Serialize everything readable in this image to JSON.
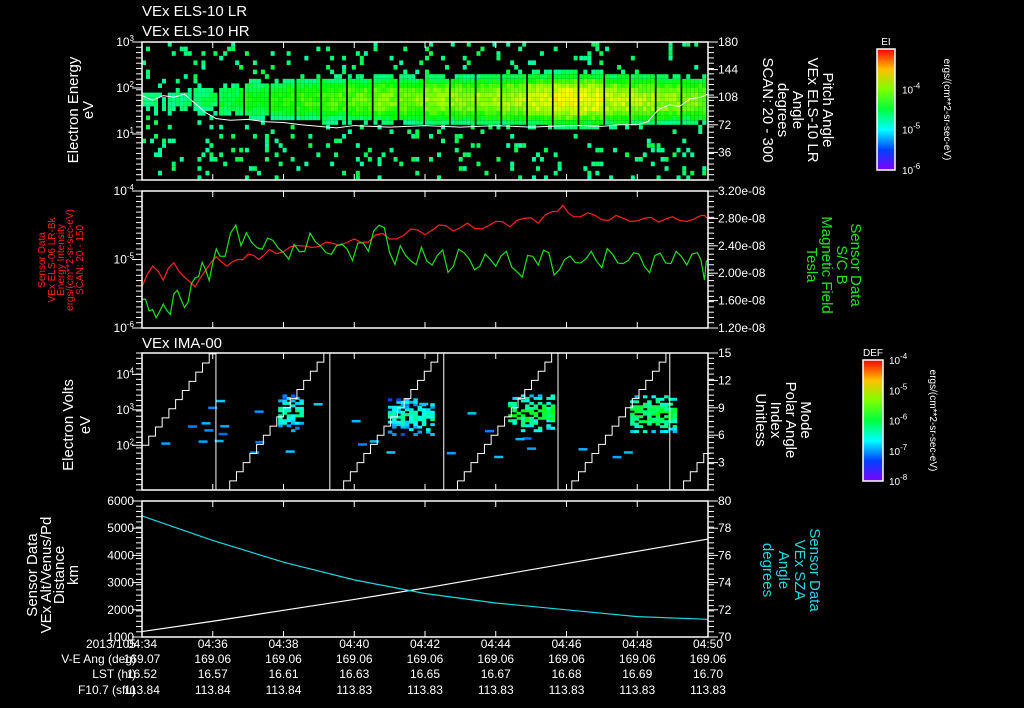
{
  "titles": {
    "p1_line1": "VEx ELS-10 LR",
    "p1_line2": "VEx ELS-10 HR",
    "p3": "VEx IMA-00"
  },
  "colors": {
    "background": "#000000",
    "axes": "#ffffff",
    "red_series": "#ff2020",
    "green_series": "#20e020",
    "cyan_series": "#20d8e0",
    "white_series": "#ffffff"
  },
  "chart_data": [
    {
      "id": "els_spectrogram",
      "type": "heatmap",
      "ylabel": [
        "Electron Energy",
        "eV"
      ],
      "yticks": [
        "10^1",
        "10^2",
        "10^3"
      ],
      "ylim": [
        1,
        1000
      ],
      "yscale": "log",
      "y2label": [
        "Pitch Angle",
        "VEx ELS-10 LR",
        "Angle",
        "degrees",
        "SCAN: 20 - 300"
      ],
      "y2ticks": [
        "36",
        "72",
        "108",
        "144",
        "180"
      ],
      "y2lim": [
        0,
        180
      ],
      "colorbar": {
        "label": "EI",
        "ticks": [
          "10^-4",
          "10^-5",
          "10^-6"
        ],
        "units": "ergs/(cm**2-sr-sec-eV)"
      },
      "band_center_eV": 50,
      "band_peak_level": [
        0.48,
        0.5,
        0.52,
        0.56,
        0.6,
        0.62,
        0.64,
        0.66,
        0.68,
        0.7,
        0.7,
        0.72,
        0.72,
        0.73,
        0.74,
        0.78,
        0.82,
        0.8,
        0.76,
        0.74,
        0.72,
        0.7
      ],
      "pitch_angle_line": {
        "t_min": [
          0,
          0.3,
          0.6,
          0.9,
          1.2,
          1.5,
          1.8,
          2.1,
          2.5,
          3,
          3.5,
          4,
          4.5,
          5,
          5.5,
          6,
          6.5,
          7,
          7.5,
          8,
          8.5,
          9,
          9.5,
          10,
          10.5,
          11,
          11.5,
          12,
          12.5,
          13,
          13.5,
          14,
          14.3,
          14.6,
          14.9,
          15.2,
          15.5,
          15.8,
          16
        ],
        "deg": [
          110,
          104,
          110,
          108,
          112,
          100,
          88,
          80,
          78,
          79,
          76,
          75,
          72,
          70,
          68,
          71,
          70,
          69,
          70,
          71,
          70,
          69,
          70,
          71,
          70,
          69,
          70,
          71,
          71,
          70,
          72,
          72,
          76,
          92,
          98,
          96,
          106,
          108,
          112
        ]
      }
    },
    {
      "id": "energy_intensity_and_bfield",
      "type": "line",
      "ylabel": [
        "Sensor Data",
        "VEx ELS-06 LR-Bk",
        "Energy Intensity",
        "ergs/(cm**2-sr-sec-eV)",
        "SCAN: 20 - 150"
      ],
      "yticks": [
        "10^-6",
        "10^-5",
        "10^-4"
      ],
      "ylim": [
        1e-06,
        0.0001
      ],
      "yscale": "log",
      "y2label": [
        "Sensor Data",
        "S/C B",
        "Magnetic Field",
        "Tesla"
      ],
      "y2ticks": [
        "1.20e-08",
        "1.60e-08",
        "2.00e-08",
        "2.40e-08",
        "2.80e-08",
        "3.20e-08"
      ],
      "y2lim": [
        1.2e-08,
        3.2e-08
      ],
      "series": [
        {
          "name": "Energy Intensity",
          "axis": "left",
          "color": "#ff2020",
          "t_min": [
            0,
            0.3,
            0.6,
            0.9,
            1.2,
            1.5,
            1.8,
            2.1,
            2.4,
            2.7,
            3.0,
            3.3,
            3.6,
            4.0,
            4.4,
            4.8,
            5.2,
            5.6,
            6.0,
            6.4,
            6.8,
            7.2,
            7.6,
            8.0,
            8.4,
            8.8,
            9.2,
            9.6,
            10.0,
            10.4,
            10.8,
            11.2,
            11.6,
            11.9,
            12.2,
            12.6,
            13.0,
            13.4,
            13.8,
            14.2,
            14.6,
            15.0,
            15.4,
            15.8,
            16.0
          ],
          "values": [
            4e-06,
            8e-06,
            5e-06,
            9e-06,
            5.5e-06,
            4e-06,
            7e-06,
            1.1e-05,
            8e-06,
            1e-05,
            1.2e-05,
            1e-05,
            1.4e-05,
            1.3e-05,
            1.6e-05,
            1.5e-05,
            1.8e-05,
            1.6e-05,
            2e-05,
            1.8e-05,
            2.4e-05,
            2e-05,
            2.8e-05,
            2.3e-05,
            3.2e-05,
            2.6e-05,
            3.4e-05,
            2.8e-05,
            3.6e-05,
            3e-05,
            4e-05,
            3.4e-05,
            5e-05,
            6.2e-05,
            4.2e-05,
            4.8e-05,
            3.8e-05,
            4.4e-05,
            3.6e-05,
            4e-05,
            3.5e-05,
            4.2e-05,
            3.6e-05,
            4.4e-05,
            3.9e-05
          ]
        },
        {
          "name": "S/C B Magnetic Field",
          "axis": "right",
          "color": "#20e020",
          "t_min": [
            0,
            0.2,
            0.4,
            0.6,
            0.8,
            1.0,
            1.2,
            1.4,
            1.6,
            1.8,
            2.0,
            2.2,
            2.5,
            2.8,
            3.1,
            3.4,
            3.7,
            4.0,
            4.3,
            4.6,
            4.9,
            5.2,
            5.5,
            5.8,
            6.1,
            6.4,
            6.7,
            7.0,
            7.3,
            7.6,
            7.9,
            8.2,
            8.5,
            8.8,
            9.1,
            9.4,
            9.7,
            10.0,
            10.3,
            10.6,
            10.9,
            11.2,
            11.5,
            11.8,
            12.1,
            12.4,
            12.7,
            13.0,
            13.3,
            13.6,
            13.9,
            14.2,
            14.5,
            14.8,
            15.1,
            15.4,
            15.7,
            15.9,
            16.0
          ],
          "values": [
            1.62e-08,
            1.45e-08,
            1.35e-08,
            1.55e-08,
            1.4e-08,
            1.75e-08,
            1.5e-08,
            1.85e-08,
            1.95e-08,
            2.05e-08,
            2.15e-08,
            2.25e-08,
            2.58e-08,
            2.4e-08,
            2.45e-08,
            2.35e-08,
            2.48e-08,
            2.3e-08,
            2.42e-08,
            2.32e-08,
            2.46e-08,
            2.3e-08,
            2.4e-08,
            2.35e-08,
            2.44e-08,
            2.32e-08,
            2.7e-08,
            2.3e-08,
            2.4e-08,
            2.18e-08,
            2.38e-08,
            2.12e-08,
            2.34e-08,
            2.1e-08,
            2.3e-08,
            2.05e-08,
            2.28e-08,
            2.1e-08,
            2.32e-08,
            2.02e-08,
            2.26e-08,
            2.12e-08,
            2.3e-08,
            2.05e-08,
            2.25e-08,
            2.15e-08,
            2.32e-08,
            2.08e-08,
            2.28e-08,
            2.14e-08,
            2.3e-08,
            2.1e-08,
            2.26e-08,
            2.15e-08,
            2.32e-08,
            2.12e-08,
            2.3e-08,
            1.9e-08,
            2.2e-08
          ]
        }
      ]
    },
    {
      "id": "ima_spectrogram",
      "type": "heatmap",
      "ylabel": [
        "Electron Volts",
        "eV"
      ],
      "yticks": [
        "10^2",
        "10^3",
        "10^4"
      ],
      "ylim": [
        5.5,
        40000
      ],
      "yscale": "log",
      "y2label": [
        "Mode",
        "Polar Angle",
        "Index",
        "Unitless"
      ],
      "y2ticks": [
        "3",
        "6",
        "9",
        "12",
        "15"
      ],
      "y2lim": [
        0,
        15
      ],
      "colorbar": {
        "label": "DEF",
        "ticks": [
          "10^-4",
          "10^-5",
          "10^-6",
          "10^-7",
          "10^-8"
        ],
        "units": "ergs/(cm**2-sr-sec-eV)"
      },
      "blobs": [
        {
          "t_min": 4.2,
          "eV": 900,
          "width_min": 0.7,
          "level": 0.5
        },
        {
          "t_min": 7.6,
          "eV": 700,
          "width_min": 1.3,
          "level": 0.5
        },
        {
          "t_min": 11.0,
          "eV": 900,
          "width_min": 1.3,
          "level": 0.6
        },
        {
          "t_min": 14.4,
          "eV": 850,
          "width_min": 1.2,
          "level": 0.6
        }
      ],
      "scan_reset_t_min": [
        2.09,
        5.31,
        8.53,
        11.76,
        14.92
      ],
      "polar_index_start": 4.9
    },
    {
      "id": "altitude_sza",
      "type": "line",
      "ylabel": [
        "Sensor Data",
        "VEx Alt/Venus/Pd",
        "Distance",
        "km"
      ],
      "yticks": [
        "1000",
        "2000",
        "3000",
        "4000",
        "5000",
        "6000"
      ],
      "ylim": [
        1000,
        6000
      ],
      "y2label": [
        "Sensor Data",
        "VEx SZA",
        "Angle",
        "degrees"
      ],
      "y2ticks": [
        "70",
        "72",
        "74",
        "76",
        "78",
        "80"
      ],
      "y2lim": [
        70,
        80
      ],
      "series": [
        {
          "name": "Altitude",
          "axis": "left",
          "color": "#ffffff",
          "t_min": [
            0,
            2,
            4,
            6,
            8,
            10,
            12,
            14,
            16
          ],
          "values": [
            1200,
            1580,
            1980,
            2380,
            2800,
            3250,
            3700,
            4150,
            4600
          ]
        },
        {
          "name": "SZA",
          "axis": "right",
          "color": "#20d8e0",
          "t_min": [
            0,
            2,
            4,
            6,
            8,
            10,
            12,
            14,
            16
          ],
          "values": [
            78.9,
            77.1,
            75.5,
            74.2,
            73.2,
            72.5,
            72.0,
            71.5,
            71.3
          ]
        }
      ]
    }
  ],
  "time_axis": {
    "date": "2013/105",
    "ticks": [
      "04:34",
      "04:36",
      "04:38",
      "04:40",
      "04:42",
      "04:44",
      "04:46",
      "04:48",
      "04:50"
    ],
    "rows": [
      {
        "label": "V-E Ang (deg)",
        "values": [
          "169.07",
          "169.06",
          "169.06",
          "169.06",
          "169.06",
          "169.06",
          "169.06",
          "169.06",
          "169.06"
        ]
      },
      {
        "label": "LST (hr)",
        "values": [
          "16.52",
          "16.57",
          "16.61",
          "16.63",
          "16.65",
          "16.67",
          "16.68",
          "16.69",
          "16.70"
        ]
      },
      {
        "label": "F10.7 (sfu)",
        "values": [
          "113.84",
          "113.84",
          "113.84",
          "113.83",
          "113.83",
          "113.83",
          "113.83",
          "113.83",
          "113.83"
        ]
      }
    ]
  }
}
